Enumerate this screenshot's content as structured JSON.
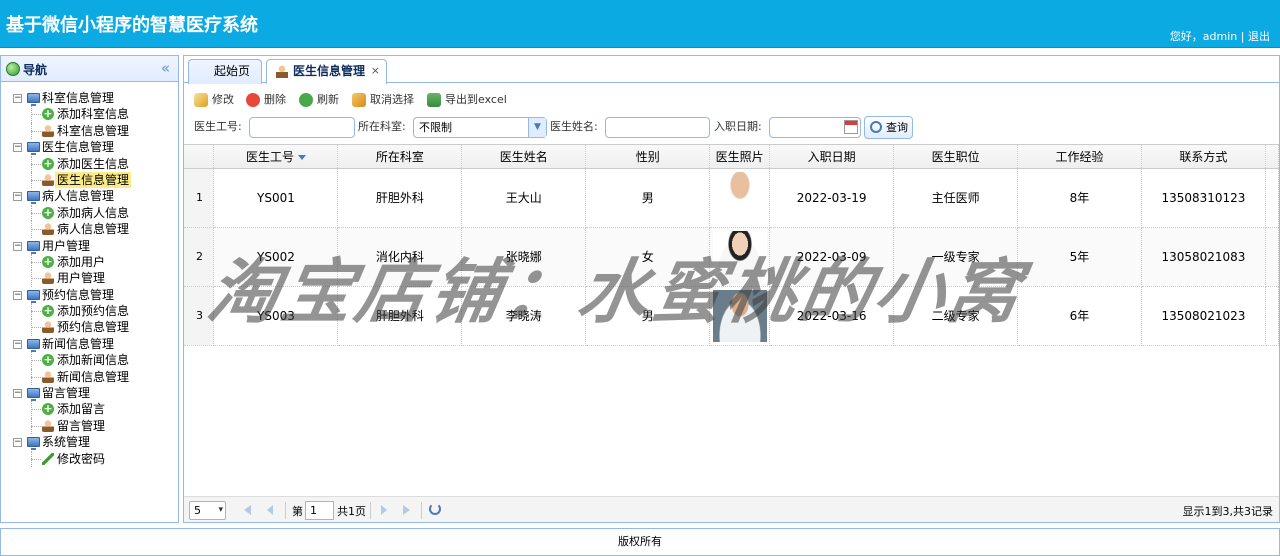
{
  "header": {
    "title": "基于微信小程序的智慧医疗系统",
    "greeting": "您好，admin",
    "separator": "|",
    "logout": "退出"
  },
  "sidebar": {
    "title": "导航",
    "collapse_icon": "«",
    "groups": [
      {
        "label": "科室信息管理",
        "children": [
          {
            "label": "添加科室信息",
            "icon": "add"
          },
          {
            "label": "科室信息管理",
            "icon": "person"
          }
        ]
      },
      {
        "label": "医生信息管理",
        "children": [
          {
            "label": "添加医生信息",
            "icon": "add"
          },
          {
            "label": "医生信息管理",
            "icon": "person",
            "selected": true
          }
        ]
      },
      {
        "label": "病人信息管理",
        "children": [
          {
            "label": "添加病人信息",
            "icon": "add"
          },
          {
            "label": "病人信息管理",
            "icon": "person"
          }
        ]
      },
      {
        "label": "用户管理",
        "children": [
          {
            "label": "添加用户",
            "icon": "add"
          },
          {
            "label": "用户管理",
            "icon": "person"
          }
        ]
      },
      {
        "label": "预约信息管理",
        "children": [
          {
            "label": "添加预约信息",
            "icon": "add"
          },
          {
            "label": "预约信息管理",
            "icon": "person"
          }
        ]
      },
      {
        "label": "新闻信息管理",
        "children": [
          {
            "label": "添加新闻信息",
            "icon": "add"
          },
          {
            "label": "新闻信息管理",
            "icon": "person"
          }
        ]
      },
      {
        "label": "留言管理",
        "children": [
          {
            "label": "添加留言",
            "icon": "add"
          },
          {
            "label": "留言管理",
            "icon": "person"
          }
        ]
      },
      {
        "label": "系统管理",
        "children": [
          {
            "label": "修改密码",
            "icon": "pencil"
          }
        ]
      }
    ]
  },
  "tabs": [
    {
      "label": "起始页"
    },
    {
      "label": "医生信息管理",
      "close": "×",
      "active": true
    }
  ],
  "toolbar": {
    "edit": "修改",
    "delete": "删除",
    "refresh": "刷新",
    "cancel": "取消选择",
    "export": "导出到excel"
  },
  "search": {
    "doctor_id_label": "医生工号:",
    "dept_label": "所在科室:",
    "dept_value": "不限制",
    "name_label": "医生姓名:",
    "hire_date_label": "入职日期:",
    "query": "查询"
  },
  "table": {
    "columns": [
      "医生工号",
      "所在科室",
      "医生姓名",
      "性别",
      "医生照片",
      "入职日期",
      "医生职位",
      "工作经验",
      "联系方式"
    ],
    "rows": [
      {
        "n": "1",
        "id": "YS001",
        "dept": "肝胆外科",
        "name": "王大山",
        "sex": "男",
        "date": "2022-03-19",
        "title": "主任医师",
        "exp": "8年",
        "phone": "13508310123"
      },
      {
        "n": "2",
        "id": "YS002",
        "dept": "消化内科",
        "name": "张晓娜",
        "sex": "女",
        "date": "2022-03-09",
        "title": "一级专家",
        "exp": "5年",
        "phone": "13058021083"
      },
      {
        "n": "3",
        "id": "YS003",
        "dept": "肝胆外科",
        "name": "李晓涛",
        "sex": "男",
        "date": "2022-03-16",
        "title": "二级专家",
        "exp": "6年",
        "phone": "13508021023"
      }
    ]
  },
  "pager": {
    "page_size": "5",
    "page_label": "第",
    "page": "1",
    "total_pages": "共1页",
    "summary": "显示1到3,共3记录"
  },
  "footer": {
    "text": "版权所有"
  },
  "watermark": "淘宝店铺：水蜜桃的小窝"
}
